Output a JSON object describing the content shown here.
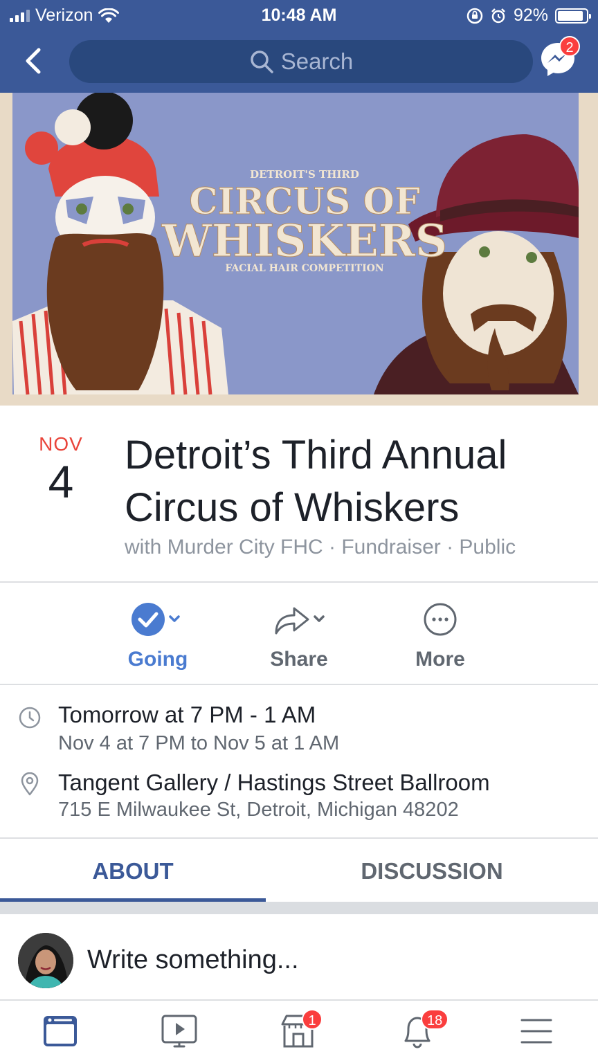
{
  "status_bar": {
    "carrier": "Verizon",
    "time": "10:48 AM",
    "battery_percent": "92%",
    "battery_level": 0.92
  },
  "header": {
    "back_icon": "chevron-left-icon",
    "search_placeholder": "Search",
    "messenger_badge": "2"
  },
  "cover": {
    "line1": "DETROIT'S THIRD",
    "line2": "CIRCUS OF",
    "line3": "WHISKERS",
    "line4": "FACIAL HAIR COMPETITION"
  },
  "event": {
    "month": "NOV",
    "day": "4",
    "title_line1": "Detroit’s Third Annual",
    "title_line2": "Circus of Whiskers",
    "subtitle": "with Murder City FHC · Fundraiser · Public"
  },
  "actions": {
    "going": "Going",
    "share": "Share",
    "more": "More"
  },
  "details": {
    "time_main": "Tomorrow at 7 PM - 1 AM",
    "time_sub": "Nov 4 at 7 PM to Nov 5 at 1 AM",
    "location_main": "Tangent Gallery / Hastings Street Ballroom",
    "location_sub": "715 E Milwaukee St, Detroit, Michigan 48202"
  },
  "tabs": [
    {
      "label": "ABOUT",
      "active": true
    },
    {
      "label": "DISCUSSION",
      "active": false
    }
  ],
  "composer": {
    "placeholder": "Write something..."
  },
  "bottom_nav": {
    "marketplace_badge": "1",
    "notifications_badge": "18"
  },
  "colors": {
    "brand": "#3b5998",
    "accent_blue": "#4a7bd0",
    "badge_red": "#fa3e3e",
    "date_red": "#e9443a"
  }
}
